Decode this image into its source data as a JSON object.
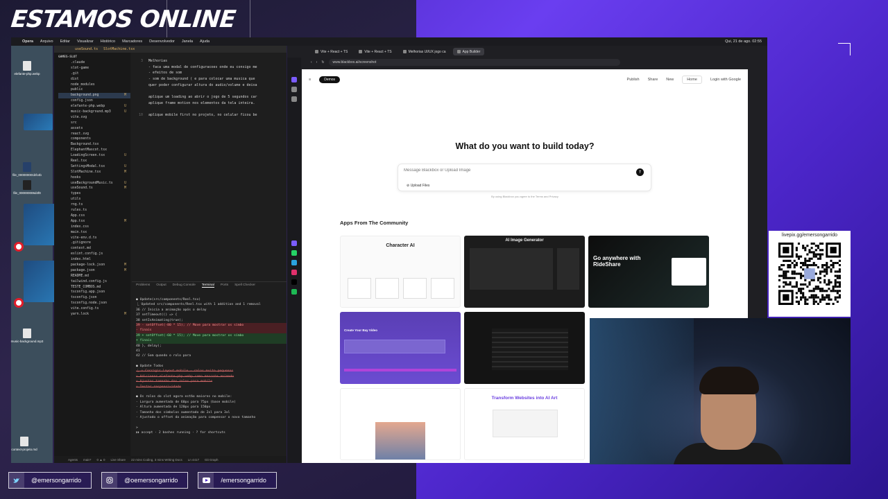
{
  "overlay": {
    "title": "ESTAMOS ONLINE",
    "socials": [
      {
        "icon": "twitter-icon",
        "handle": "@emersongarrido"
      },
      {
        "icon": "instagram-icon",
        "handle": "@oemersongarrido"
      },
      {
        "icon": "youtube-icon",
        "handle": "/emersongarrido"
      }
    ],
    "qr_label": "livepix.gg/emersongarrido"
  },
  "menubar": {
    "app": "Opera",
    "items": [
      "Arquivo",
      "Editar",
      "Visualizar",
      "Histórico",
      "Marcadores",
      "Desenvolvedor",
      "Janela",
      "Ajuda"
    ],
    "clock": "Qui, 21 de ago. 02:55"
  },
  "desktop": {
    "icons": [
      "elefante-php.webp",
      "file_000000001bfc4b",
      "file_000000006d4f8",
      "music-background.mp3",
      "context-projeto.md"
    ]
  },
  "editor": {
    "project": "GAMES-SLOT",
    "tabs": [
      "useSound.ts",
      "SlotMachine.tsx"
    ],
    "files": [
      {
        "name": ".claude",
        "mark": ""
      },
      {
        "name": "slot-game",
        "mark": ""
      },
      {
        "name": ".git",
        "mark": ""
      },
      {
        "name": "dist",
        "mark": ""
      },
      {
        "name": "node_modules",
        "mark": ""
      },
      {
        "name": "public",
        "mark": ""
      },
      {
        "name": "background.png",
        "mark": "M"
      },
      {
        "name": "config.json",
        "mark": ""
      },
      {
        "name": "elefante-php.webp",
        "mark": "U"
      },
      {
        "name": "music-background.mp3",
        "mark": "U"
      },
      {
        "name": "vite.svg",
        "mark": ""
      },
      {
        "name": "src",
        "mark": ""
      },
      {
        "name": "assets",
        "mark": ""
      },
      {
        "name": "react.svg",
        "mark": ""
      },
      {
        "name": "components",
        "mark": ""
      },
      {
        "name": "Background.tsx",
        "mark": ""
      },
      {
        "name": "ElephantMascot.tsx",
        "mark": ""
      },
      {
        "name": "LoadingScreen.tsx",
        "mark": "U"
      },
      {
        "name": "Reel.tsx",
        "mark": ""
      },
      {
        "name": "SettingsModal.tsx",
        "mark": "U"
      },
      {
        "name": "SlotMachine.tsx",
        "mark": "M"
      },
      {
        "name": "hooks",
        "mark": ""
      },
      {
        "name": "useBackgroundMusic.ts",
        "mark": "U"
      },
      {
        "name": "useSound.ts",
        "mark": "M"
      },
      {
        "name": "types",
        "mark": ""
      },
      {
        "name": "utils",
        "mark": ""
      },
      {
        "name": "rng.ts",
        "mark": ""
      },
      {
        "name": "rules.ts",
        "mark": ""
      },
      {
        "name": "App.css",
        "mark": ""
      },
      {
        "name": "App.tsx",
        "mark": "M"
      },
      {
        "name": "index.css",
        "mark": ""
      },
      {
        "name": "main.tsx",
        "mark": ""
      },
      {
        "name": "vite-env.d.ts",
        "mark": ""
      },
      {
        "name": ".gitignore",
        "mark": ""
      },
      {
        "name": "context.md",
        "mark": ""
      },
      {
        "name": "eslint.config.js",
        "mark": ""
      },
      {
        "name": "index.html",
        "mark": ""
      },
      {
        "name": "package-lock.json",
        "mark": "M"
      },
      {
        "name": "package.json",
        "mark": "M"
      },
      {
        "name": "README.md",
        "mark": ""
      },
      {
        "name": "tailwind.config.js",
        "mark": ""
      },
      {
        "name": "TESTE_COMBOS.md",
        "mark": ""
      },
      {
        "name": "tsconfig.app.json",
        "mark": ""
      },
      {
        "name": "tsconfig.json",
        "mark": ""
      },
      {
        "name": "tsconfig.node.json",
        "mark": ""
      },
      {
        "name": "vite.config.ts",
        "mark": ""
      },
      {
        "name": "yarn.lock",
        "mark": "M"
      }
    ],
    "code": [
      {
        "n": "3",
        "t": "Melhorias"
      },
      {
        "n": "",
        "t": "- faca uma modal de configuracoes onde eu consigo me"
      },
      {
        "n": "",
        "t": "- efeitos de som"
      },
      {
        "n": "",
        "t": "- som de background ( e para colocar uma musica que"
      },
      {
        "n": "",
        "t": "quer poder configurar altura do audio/volume e deixa"
      },
      {
        "n": "",
        "t": ""
      },
      {
        "n": "",
        "t": "aplique um loading ao abrir o jogo de 5 segundos car"
      },
      {
        "n": "",
        "t": "aplique frame motion nos elementos da tela inteira."
      },
      {
        "n": "",
        "t": ""
      },
      {
        "n": "10",
        "t": "aplique mobile first no projeto, no celular ficou be"
      }
    ],
    "panel_tabs": [
      "Problems",
      "Output",
      "Debug Console",
      "Terminal",
      "Ports",
      "Spell Checker"
    ],
    "terminal": [
      {
        "c": "",
        "t": "● Update(src/components/Reel.tsx)"
      },
      {
        "c": "",
        "t": "  ⎿ Updated src/components/Reel.tsx with 1 addition and 1 removal"
      },
      {
        "c": "",
        "t": "      36          // Inicia a animação após o delay"
      },
      {
        "c": "",
        "t": "      37          setTimeout(() => {"
      },
      {
        "c": "",
        "t": "      38            setIsAnimating(true);"
      },
      {
        "c": "red",
        "t": "      39 -          setOffset(-80 * 15); // Move para mostrar os símbo"
      },
      {
        "c": "red",
        "t": "         - finais"
      },
      {
        "c": "green",
        "t": "      39 +          setOffset(-60 * 15); // Move para mostrar os símbo"
      },
      {
        "c": "green",
        "t": "         + finais"
      },
      {
        "c": "",
        "t": "      40          }, delay);"
      },
      {
        "c": "",
        "t": "      41"
      },
      {
        "c": "",
        "t": "      42          // Som quando o rolo para"
      },
      {
        "c": "",
        "t": ""
      },
      {
        "c": "",
        "t": "● Update Todos"
      },
      {
        "c": "strike",
        "t": "  ⎿ ☒ Corrigir layout mobile - rolos muito pequenos"
      },
      {
        "c": "strike",
        "t": "     ☒ Adicionar elefante-php.webp como mascote animado"
      },
      {
        "c": "strike",
        "t": "     ☒ Ajustar tamanho dos rolos para mobile"
      },
      {
        "c": "strike",
        "t": "     ☒ Testar responsividade"
      },
      {
        "c": "",
        "t": ""
      },
      {
        "c": "",
        "t": "● Os rolos do slot agora estão maiores no mobile:"
      },
      {
        "c": "",
        "t": "  - Largura aumentada de 60px para 75px (base mobile)"
      },
      {
        "c": "",
        "t": "  - Altura aumentada de 120px para 150px"
      },
      {
        "c": "",
        "t": "  - Tamanho dos símbolos aumentado de 2xl para 3xl"
      },
      {
        "c": "",
        "t": "  - Ajustado o offset da animação para compensar o novo tamanho"
      },
      {
        "c": "",
        "t": ""
      },
      {
        "c": "",
        "t": "> "
      },
      {
        "c": "",
        "t": "  ⏵⏵ accept · 2 bashes running · ? for shortcuts"
      }
    ],
    "status": [
      "Agents",
      "main*",
      "0 ▲ 0",
      "Live Share",
      "22 mins Coding, 3 mins Writing Docs",
      "Ln 4417",
      "Git Graph"
    ]
  },
  "browser": {
    "tabs": [
      {
        "label": "Vite + React + TS",
        "active": false
      },
      {
        "label": "Vite + React + TS",
        "active": false
      },
      {
        "label": "Melhorias UI/UX jogo ca",
        "active": false
      },
      {
        "label": "App Builder",
        "active": true
      }
    ],
    "url": "www.blackbox.ai/screenshot",
    "page": {
      "demos": "Demos",
      "nav": [
        "Publish",
        "Share",
        "New",
        "Home"
      ],
      "login": "Login with Google",
      "hero": "What do you want to build today?",
      "input_placeholder": "Message Blackbox or Upload Image",
      "upload": "Upload Files",
      "terms": "By using Blackbox you agree to the Terms and Privacy",
      "section": "Apps From The Community",
      "cards": [
        {
          "title": "Character AI",
          "theme": "light"
        },
        {
          "title": "AI Image Generator",
          "theme": "dark"
        },
        {
          "title": "Go anywhere with RideShare",
          "theme": "ride"
        },
        {
          "title": "Create Your Bay Video",
          "theme": "purple"
        },
        {
          "title": "",
          "theme": "dark"
        },
        {
          "title": "",
          "theme": "blank"
        },
        {
          "title": "",
          "theme": "light2"
        },
        {
          "title": "Transform Websites into AI Art",
          "theme": "light3"
        }
      ]
    }
  }
}
